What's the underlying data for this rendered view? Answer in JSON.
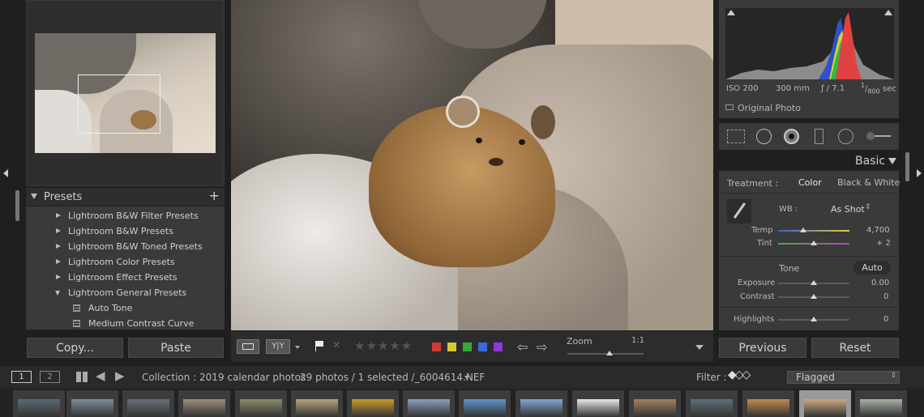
{
  "navigator": {},
  "presets": {
    "header": "Presets",
    "add": "+",
    "items": [
      {
        "label": "Lightroom B&W Filter Presets",
        "expanded": false
      },
      {
        "label": "Lightroom B&W Presets",
        "expanded": false
      },
      {
        "label": "Lightroom B&W Toned Presets",
        "expanded": false
      },
      {
        "label": "Lightroom Color Presets",
        "expanded": false
      },
      {
        "label": "Lightroom Effect Presets",
        "expanded": false
      },
      {
        "label": "Lightroom General Presets",
        "expanded": true
      }
    ],
    "subitems": [
      "Auto Tone",
      "Medium Contrast Curve"
    ]
  },
  "left_buttons": {
    "copy": "Copy...",
    "paste": "Paste"
  },
  "toolbar": {
    "zoom_label": "Zoom",
    "zoom_value": "1:1",
    "color_labels": [
      "#d23a3a",
      "#d8c832",
      "#3aa83a",
      "#3a6ad8",
      "#8a3ad8"
    ]
  },
  "histogram": {
    "iso": "ISO 200",
    "focal": "300 mm",
    "aperture": "ƒ / 7.1",
    "shutter_num": "1",
    "shutter_den": "800",
    "shutter_unit": "sec",
    "original": "Original Photo"
  },
  "basic": {
    "title": "Basic",
    "treatment_label": "Treatment :",
    "color": "Color",
    "bw": "Black & White",
    "wb_label": "WB :",
    "wb_value": "As Shot",
    "temp_label": "Temp",
    "temp_value": "4,700",
    "tint_label": "Tint",
    "tint_value": "+ 2",
    "tone_label": "Tone",
    "auto": "Auto",
    "exposure_label": "Exposure",
    "exposure_value": "0.00",
    "contrast_label": "Contrast",
    "contrast_value": "0",
    "highlights_label": "Highlights",
    "highlights_value": "0",
    "levels": {
      "temp": 0.35,
      "tint": 0.5,
      "exposure": 0.5,
      "contrast": 0.5,
      "highlights": 0.5
    }
  },
  "right_buttons": {
    "previous": "Previous",
    "reset": "Reset"
  },
  "filmstrip": {
    "view1": "1",
    "view2": "2",
    "collection": "Collection : 2019 calendar photos",
    "count": "29 photos / 1 selected /_6004614.NEF",
    "filter_label": "Filter :",
    "filter_value": "Flagged"
  }
}
